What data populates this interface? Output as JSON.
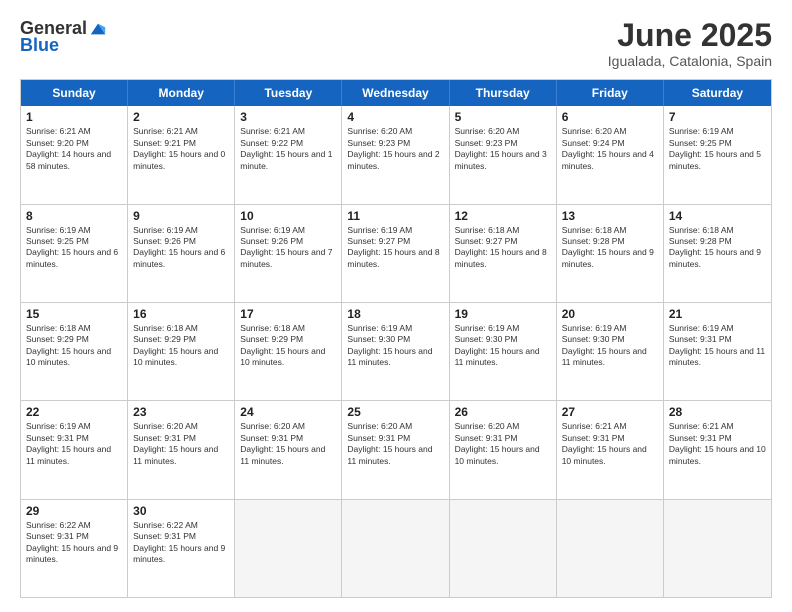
{
  "logo": {
    "general": "General",
    "blue": "Blue"
  },
  "header": {
    "month": "June 2025",
    "location": "Igualada, Catalonia, Spain"
  },
  "dayNames": [
    "Sunday",
    "Monday",
    "Tuesday",
    "Wednesday",
    "Thursday",
    "Friday",
    "Saturday"
  ],
  "rows": [
    [
      {
        "day": "1",
        "sunrise": "6:21 AM",
        "sunset": "9:20 PM",
        "daylight": "14 hours and 58 minutes."
      },
      {
        "day": "2",
        "sunrise": "6:21 AM",
        "sunset": "9:21 PM",
        "daylight": "15 hours and 0 minutes."
      },
      {
        "day": "3",
        "sunrise": "6:21 AM",
        "sunset": "9:22 PM",
        "daylight": "15 hours and 1 minute."
      },
      {
        "day": "4",
        "sunrise": "6:20 AM",
        "sunset": "9:23 PM",
        "daylight": "15 hours and 2 minutes."
      },
      {
        "day": "5",
        "sunrise": "6:20 AM",
        "sunset": "9:23 PM",
        "daylight": "15 hours and 3 minutes."
      },
      {
        "day": "6",
        "sunrise": "6:20 AM",
        "sunset": "9:24 PM",
        "daylight": "15 hours and 4 minutes."
      },
      {
        "day": "7",
        "sunrise": "6:19 AM",
        "sunset": "9:25 PM",
        "daylight": "15 hours and 5 minutes."
      }
    ],
    [
      {
        "day": "8",
        "sunrise": "6:19 AM",
        "sunset": "9:25 PM",
        "daylight": "15 hours and 6 minutes."
      },
      {
        "day": "9",
        "sunrise": "6:19 AM",
        "sunset": "9:26 PM",
        "daylight": "15 hours and 6 minutes."
      },
      {
        "day": "10",
        "sunrise": "6:19 AM",
        "sunset": "9:26 PM",
        "daylight": "15 hours and 7 minutes."
      },
      {
        "day": "11",
        "sunrise": "6:19 AM",
        "sunset": "9:27 PM",
        "daylight": "15 hours and 8 minutes."
      },
      {
        "day": "12",
        "sunrise": "6:18 AM",
        "sunset": "9:27 PM",
        "daylight": "15 hours and 8 minutes."
      },
      {
        "day": "13",
        "sunrise": "6:18 AM",
        "sunset": "9:28 PM",
        "daylight": "15 hours and 9 minutes."
      },
      {
        "day": "14",
        "sunrise": "6:18 AM",
        "sunset": "9:28 PM",
        "daylight": "15 hours and 9 minutes."
      }
    ],
    [
      {
        "day": "15",
        "sunrise": "6:18 AM",
        "sunset": "9:29 PM",
        "daylight": "15 hours and 10 minutes."
      },
      {
        "day": "16",
        "sunrise": "6:18 AM",
        "sunset": "9:29 PM",
        "daylight": "15 hours and 10 minutes."
      },
      {
        "day": "17",
        "sunrise": "6:18 AM",
        "sunset": "9:29 PM",
        "daylight": "15 hours and 10 minutes."
      },
      {
        "day": "18",
        "sunrise": "6:19 AM",
        "sunset": "9:30 PM",
        "daylight": "15 hours and 11 minutes."
      },
      {
        "day": "19",
        "sunrise": "6:19 AM",
        "sunset": "9:30 PM",
        "daylight": "15 hours and 11 minutes."
      },
      {
        "day": "20",
        "sunrise": "6:19 AM",
        "sunset": "9:30 PM",
        "daylight": "15 hours and 11 minutes."
      },
      {
        "day": "21",
        "sunrise": "6:19 AM",
        "sunset": "9:31 PM",
        "daylight": "15 hours and 11 minutes."
      }
    ],
    [
      {
        "day": "22",
        "sunrise": "6:19 AM",
        "sunset": "9:31 PM",
        "daylight": "15 hours and 11 minutes."
      },
      {
        "day": "23",
        "sunrise": "6:20 AM",
        "sunset": "9:31 PM",
        "daylight": "15 hours and 11 minutes."
      },
      {
        "day": "24",
        "sunrise": "6:20 AM",
        "sunset": "9:31 PM",
        "daylight": "15 hours and 11 minutes."
      },
      {
        "day": "25",
        "sunrise": "6:20 AM",
        "sunset": "9:31 PM",
        "daylight": "15 hours and 11 minutes."
      },
      {
        "day": "26",
        "sunrise": "6:20 AM",
        "sunset": "9:31 PM",
        "daylight": "15 hours and 10 minutes."
      },
      {
        "day": "27",
        "sunrise": "6:21 AM",
        "sunset": "9:31 PM",
        "daylight": "15 hours and 10 minutes."
      },
      {
        "day": "28",
        "sunrise": "6:21 AM",
        "sunset": "9:31 PM",
        "daylight": "15 hours and 10 minutes."
      }
    ],
    [
      {
        "day": "29",
        "sunrise": "6:22 AM",
        "sunset": "9:31 PM",
        "daylight": "15 hours and 9 minutes."
      },
      {
        "day": "30",
        "sunrise": "6:22 AM",
        "sunset": "9:31 PM",
        "daylight": "15 hours and 9 minutes."
      },
      null,
      null,
      null,
      null,
      null
    ]
  ]
}
